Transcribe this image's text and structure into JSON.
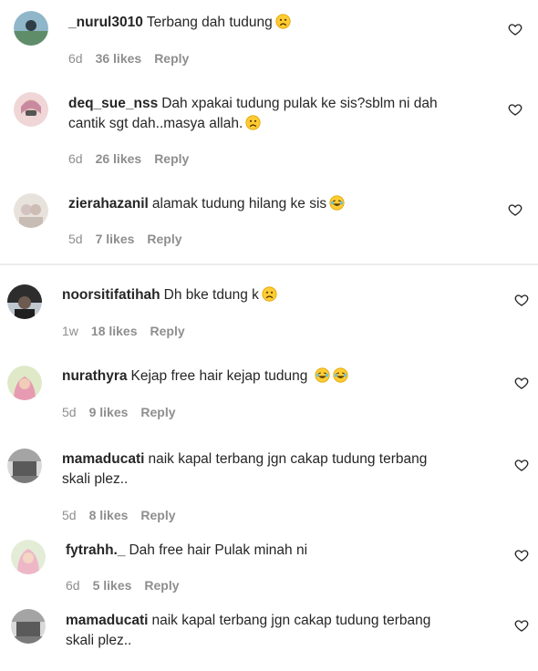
{
  "comments": [
    {
      "user": "_nurul3010",
      "text": "Terbang dah tudung",
      "time": "6d",
      "likes": "36 likes",
      "reply": "Reply",
      "emoji": [
        "sad-face-emoji"
      ],
      "avatar_color": "#5f8d6a"
    },
    {
      "user": "deq_sue_nss",
      "text": "Dah xpakai tudung pulak ke sis?sblm ni dah",
      "text2": "cantik sgt dah..masya allah.",
      "time": "6d",
      "likes": "26 likes",
      "reply": "Reply",
      "emoji": [
        "sad-face-emoji"
      ],
      "avatar_color": "#d9a3a8"
    },
    {
      "user": "zierahazanil",
      "text": "alamak tudung hilang ke sis",
      "time": "5d",
      "likes": "7 likes",
      "reply": "Reply",
      "emoji": [
        "laughing-face-emoji"
      ],
      "avatar_color": "#d8cfc8"
    },
    {
      "user": "noorsitifatihah",
      "text": "Dh bke tdung k",
      "time": "1w",
      "likes": "18 likes",
      "reply": "Reply",
      "emoji": [
        "sad-face-emoji"
      ],
      "avatar_color": "#3b3b3b"
    },
    {
      "user": "nurathyra",
      "text": "Kejap free hair kejap tudung",
      "time": "5d",
      "likes": "9 likes",
      "reply": "Reply",
      "emoji": [
        "laughing-face-emoji",
        "laughing-face-emoji"
      ],
      "avatar_color": "#e6a9b8"
    },
    {
      "user": "mamaducati",
      "text": "naik kapal terbang jgn cakap tudung terbang",
      "text2": "skali plez..",
      "time": "5d",
      "likes": "8 likes",
      "reply": "Reply",
      "emoji": [],
      "avatar_color": "#6b6b6b"
    },
    {
      "user": "fytrahh._",
      "text": "Dah free hair Pulak minah ni",
      "time": "6d",
      "likes": "5 likes",
      "reply": "Reply",
      "emoji": [],
      "avatar_color": "#e2b1c3"
    },
    {
      "user": "mamaducati",
      "text": "naik kapal terbang jgn cakap tudung terbang",
      "text2": "skali plez..",
      "time": "",
      "likes": "",
      "reply": "",
      "emoji": [],
      "avatar_color": "#6b6b6b"
    }
  ],
  "colors": {
    "text": "#262626",
    "meta": "#8e8e8e",
    "background": "#ffffff"
  },
  "icons": {
    "like": "heart-outline-icon"
  }
}
